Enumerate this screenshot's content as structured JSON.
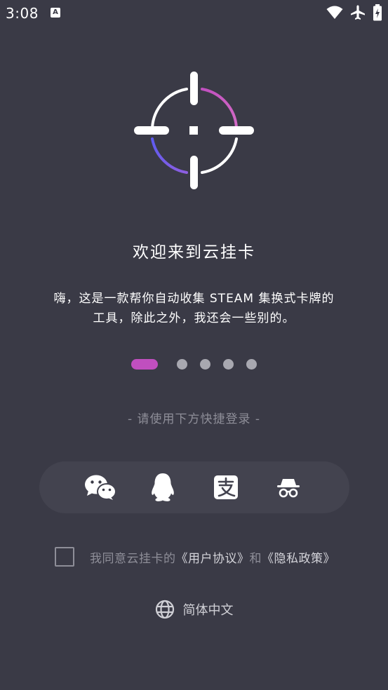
{
  "status_bar": {
    "time": "3:08",
    "notification_icon": "text-a-icon",
    "icons": [
      "wifi-icon",
      "airplane-icon",
      "battery-icon"
    ]
  },
  "logo": {
    "icon": "crosshair-icon",
    "gradient": [
      "#c04fbf",
      "#6e5ef0"
    ]
  },
  "welcome": {
    "title": "欢迎来到云挂卡",
    "description_line1": "嗨，这是一款帮你自动收集 STEAM 集换式卡牌的",
    "description_line2": "工具，除此之外，我还会一些别的。"
  },
  "pager": {
    "total": 5,
    "active_index": 0,
    "active_color": "#c04fbf"
  },
  "login": {
    "hint": "- 请使用下方快捷登录 -",
    "methods": [
      {
        "name": "wechat",
        "icon": "wechat-icon"
      },
      {
        "name": "qq",
        "icon": "qq-penguin-icon"
      },
      {
        "name": "alipay",
        "icon": "alipay-icon"
      },
      {
        "name": "incognito",
        "icon": "incognito-icon"
      }
    ]
  },
  "agreement": {
    "checked": false,
    "prefix": "我同意云挂卡的",
    "user_agreement": "《用户协议》",
    "conjunction": "和",
    "privacy_policy": "《隐私政策》"
  },
  "language": {
    "icon": "globe-icon",
    "label": "简体中文"
  },
  "colors": {
    "background": "#3a3a46",
    "panel": "#43434f",
    "muted_text": "#8e8e98"
  }
}
